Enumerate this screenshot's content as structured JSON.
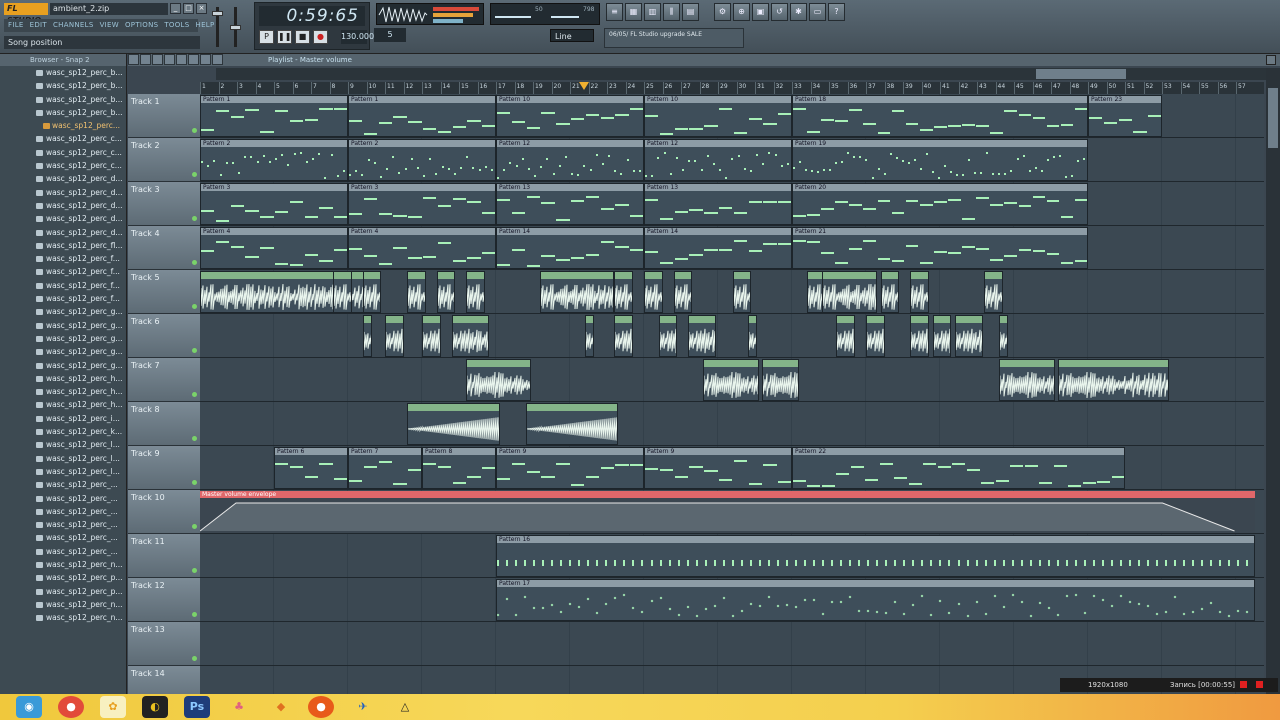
{
  "app": {
    "logo": "FL STUDIO",
    "filename": "ambient_2.zip",
    "hint": "Song position",
    "menus": [
      "FILE",
      "EDIT",
      "CHANNELS",
      "VIEW",
      "OPTIONS",
      "TOOLS",
      "HELP"
    ],
    "time": "0:59:65",
    "tempo": "130.000",
    "pattern_num": "5",
    "snap": "Line",
    "news": "06/05/ FL Studio upgrade SALE",
    "cpu_label": "50",
    "mem_label": "798"
  },
  "browser": {
    "title": "Browser - Snap 2",
    "items": [
      "wasc_sp12_perc_b...",
      "wasc_sp12_perc_b...",
      "wasc_sp12_perc_b...",
      "wasc_sp12_perc_b...",
      "wasc_sp12_perc...",
      "wasc_sp12_perc_c...",
      "wasc_sp12_perc_c...",
      "wasc_sp12_perc_c...",
      "wasc_sp12_perc_d...",
      "wasc_sp12_perc_d...",
      "wasc_sp12_perc_d...",
      "wasc_sp12_perc_d...",
      "wasc_sp12_perc_d...",
      "wasc_sp12_perc_fl...",
      "wasc_sp12_perc_f...",
      "wasc_sp12_perc_f...",
      "wasc_sp12_perc_f...",
      "wasc_sp12_perc_f...",
      "wasc_sp12_perc_g...",
      "wasc_sp12_perc_g...",
      "wasc_sp12_perc_g...",
      "wasc_sp12_perc_g...",
      "wasc_sp12_perc_g...",
      "wasc_sp12_perc_h...",
      "wasc_sp12_perc_h...",
      "wasc_sp12_perc_h...",
      "wasc_sp12_perc_i...",
      "wasc_sp12_perc_k...",
      "wasc_sp12_perc_l...",
      "wasc_sp12_perc_l...",
      "wasc_sp12_perc_l...",
      "wasc_sp12_perc_...",
      "wasc_sp12_perc_...",
      "wasc_sp12_perc_...",
      "wasc_sp12_perc_...",
      "wasc_sp12_perc_...",
      "wasc_sp12_perc_...",
      "wasc_sp12_perc_n...",
      "wasc_sp12_perc_p...",
      "wasc_sp12_perc_p...",
      "wasc_sp12_perc_n...",
      "wasc_sp12_perc_n..."
    ]
  },
  "playlist": {
    "title": "Playlist - Master volume",
    "bars": [
      1,
      2,
      3,
      4,
      5,
      6,
      7,
      8,
      9,
      10,
      11,
      12,
      13,
      14,
      15,
      16,
      17,
      18,
      19,
      20,
      21,
      22,
      23,
      24,
      25,
      26,
      27,
      28,
      29,
      30,
      31,
      32,
      33,
      34,
      35,
      36,
      37,
      38,
      39,
      40,
      41,
      42,
      43,
      44,
      45,
      46,
      47,
      48,
      49,
      50,
      51,
      52,
      53,
      54,
      55,
      56,
      57
    ],
    "tracks": [
      {
        "name": "Track 1",
        "clips": [
          {
            "label": "Pattern 1",
            "start": 0,
            "len": 8
          },
          {
            "label": "Pattern 1",
            "start": 8,
            "len": 8
          },
          {
            "label": "Pattern 10",
            "start": 16,
            "len": 8
          },
          {
            "label": "Pattern 10",
            "start": 24,
            "len": 8
          },
          {
            "label": "Pattern 18",
            "start": 32,
            "len": 16
          },
          {
            "label": "Pattern 23",
            "start": 48,
            "len": 4
          }
        ]
      },
      {
        "name": "Track 2",
        "clips": [
          {
            "label": "Pattern 2",
            "start": 0,
            "len": 8
          },
          {
            "label": "Pattern 2",
            "start": 8,
            "len": 8
          },
          {
            "label": "Pattern 12",
            "start": 16,
            "len": 8
          },
          {
            "label": "Pattern 12",
            "start": 24,
            "len": 8
          },
          {
            "label": "Pattern 19",
            "start": 32,
            "len": 16
          }
        ]
      },
      {
        "name": "Track 3",
        "clips": [
          {
            "label": "Pattern 3",
            "start": 0,
            "len": 8
          },
          {
            "label": "Pattern 3",
            "start": 8,
            "len": 8
          },
          {
            "label": "Pattern 13",
            "start": 16,
            "len": 8
          },
          {
            "label": "Pattern 13",
            "start": 24,
            "len": 8
          },
          {
            "label": "Pattern 20",
            "start": 32,
            "len": 16
          }
        ]
      },
      {
        "name": "Track 4",
        "clips": [
          {
            "label": "Pattern 4",
            "start": 0,
            "len": 8
          },
          {
            "label": "Pattern 4",
            "start": 8,
            "len": 8
          },
          {
            "label": "Pattern 14",
            "start": 16,
            "len": 8
          },
          {
            "label": "Pattern 14",
            "start": 24,
            "len": 8
          },
          {
            "label": "Pattern 21",
            "start": 32,
            "len": 16
          }
        ]
      },
      {
        "name": "Track 5",
        "clips": []
      },
      {
        "name": "Track 6",
        "clips": []
      },
      {
        "name": "Track 7",
        "clips": []
      },
      {
        "name": "Track 8",
        "clips": []
      },
      {
        "name": "Track 9",
        "clips": [
          {
            "label": "Pattern 6",
            "start": 4,
            "len": 4
          },
          {
            "label": "Pattern 7",
            "start": 8,
            "len": 4
          },
          {
            "label": "Pattern 8",
            "start": 12,
            "len": 4
          },
          {
            "label": "Pattern 9",
            "start": 16,
            "len": 8
          },
          {
            "label": "Pattern 9",
            "start": 24,
            "len": 8
          },
          {
            "label": "Pattern 22",
            "start": 32,
            "len": 18
          }
        ]
      },
      {
        "name": "Track 10",
        "clips": [
          {
            "label": "Master volume envelope",
            "start": 0,
            "len": 57
          }
        ]
      },
      {
        "name": "Track 11",
        "clips": [
          {
            "label": "Pattern 16",
            "start": 16,
            "len": 41
          }
        ]
      },
      {
        "name": "Track 12",
        "clips": [
          {
            "label": "Pattern 17",
            "start": 16,
            "len": 41
          }
        ]
      },
      {
        "name": "Track 13",
        "clips": []
      },
      {
        "name": "Track 14",
        "clips": []
      }
    ]
  },
  "recorder": {
    "resolution": "1920x1080",
    "status": "Запись [00:00:55]"
  },
  "colors": {
    "accent": "#e8a020",
    "note": "#a8f0b8",
    "audio": "#84b489",
    "automation": "#e0676a"
  },
  "taskbar": {
    "icons": [
      "windows-orb-icon",
      "chrome-icon",
      "fl-studio-icon",
      "app-icon",
      "photoshop-icon",
      "app-icon",
      "app-icon",
      "firefox-icon",
      "app-icon",
      "app-icon"
    ]
  }
}
